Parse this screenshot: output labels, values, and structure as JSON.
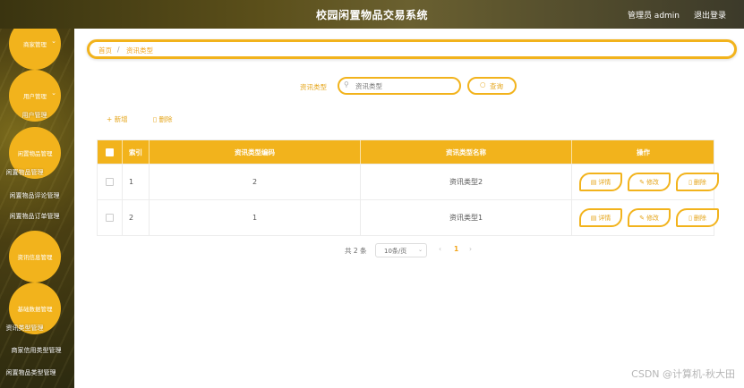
{
  "header": {
    "title": "校园闲置物品交易系统",
    "admin_label": "管理员 admin",
    "logout_label": "退出登录"
  },
  "sidebar": {
    "groups": [
      {
        "label": "商家管理"
      },
      {
        "label": "用户管理"
      },
      {
        "label": "闲置物品管理"
      },
      {
        "label": "资讯信息管理"
      },
      {
        "label": "基础数据管理"
      }
    ],
    "items": [
      {
        "label": "用户管理"
      },
      {
        "label": "闲置物品管理"
      },
      {
        "label": "闲置物品评论管理"
      },
      {
        "label": "闲置物品订单管理"
      },
      {
        "label": "资讯类型管理"
      },
      {
        "label": "商家信用类型管理"
      },
      {
        "label": "闲置物品类型管理"
      }
    ]
  },
  "breadcrumb": {
    "home": "首页",
    "separator": "/",
    "current": "资讯类型"
  },
  "search": {
    "label": "资讯类型",
    "placeholder": "资讯类型",
    "button": "查询"
  },
  "toolbar": {
    "add": "新增",
    "delete": "删除"
  },
  "table": {
    "columns": [
      "索引",
      "资讯类型编码",
      "资讯类型名称",
      "操作"
    ],
    "rows": [
      {
        "index": "1",
        "code": "2",
        "name": "资讯类型2"
      },
      {
        "index": "2",
        "code": "1",
        "name": "资讯类型1"
      }
    ],
    "actions": {
      "detail": "详情",
      "edit": "修改",
      "delete": "删除"
    }
  },
  "pagination": {
    "total": "共 2 条",
    "page_size": "10条/页",
    "current_page": "1"
  },
  "watermark": "CSDN @计算机-秋大田",
  "colors": {
    "accent": "#f2b31c"
  }
}
